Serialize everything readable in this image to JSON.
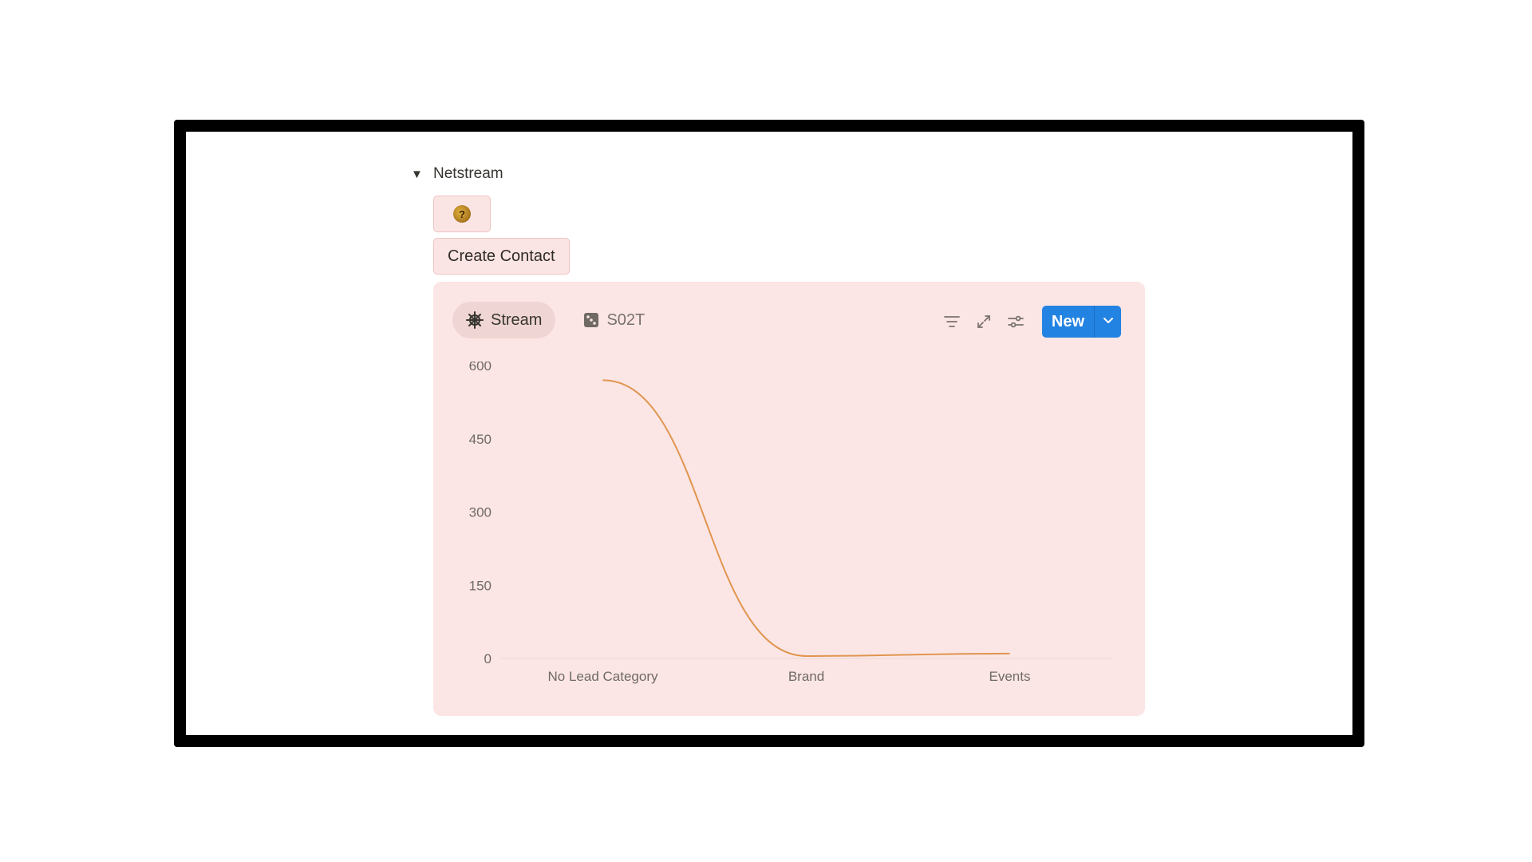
{
  "toggle": {
    "arrow": "▼",
    "title": "Netstream"
  },
  "emoji_button": {
    "icon": "coin-emoji-icon",
    "glyph": "?"
  },
  "create_contact": {
    "label": "Create Contact"
  },
  "tabs": [
    {
      "label": "Stream",
      "icon": "helm-icon",
      "active": true
    },
    {
      "label": "S02T",
      "icon": "dice-icon",
      "active": false
    }
  ],
  "toolbar": {
    "icons": [
      "filter-icon",
      "expand-icon",
      "settings-sliders-icon"
    ],
    "new_label": "New",
    "dropdown_icon": "chevron-down-icon"
  },
  "colors": {
    "panel_bg": "#fbe6e5",
    "accent": "#2383e2",
    "line": "#e0954f"
  },
  "chart_data": {
    "type": "line",
    "categories": [
      "No Lead Category",
      "Brand",
      "Events"
    ],
    "series": [
      {
        "values": [
          570,
          5,
          10
        ]
      }
    ],
    "ylim": [
      0,
      600
    ],
    "yticks": [
      0,
      150,
      300,
      450,
      600
    ],
    "grid": false,
    "smooth": true
  }
}
